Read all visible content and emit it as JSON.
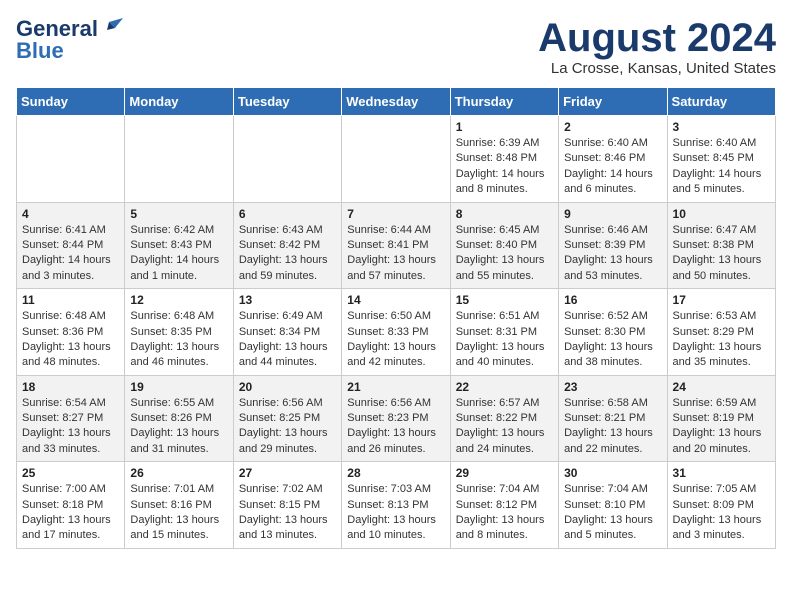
{
  "header": {
    "logo_line1": "General",
    "logo_line2": "Blue",
    "month_title": "August 2024",
    "location": "La Crosse, Kansas, United States"
  },
  "calendar": {
    "days_of_week": [
      "Sunday",
      "Monday",
      "Tuesday",
      "Wednesday",
      "Thursday",
      "Friday",
      "Saturday"
    ],
    "weeks": [
      [
        {
          "day": "",
          "info": ""
        },
        {
          "day": "",
          "info": ""
        },
        {
          "day": "",
          "info": ""
        },
        {
          "day": "",
          "info": ""
        },
        {
          "day": "1",
          "info": "Sunrise: 6:39 AM\nSunset: 8:48 PM\nDaylight: 14 hours and 8 minutes."
        },
        {
          "day": "2",
          "info": "Sunrise: 6:40 AM\nSunset: 8:46 PM\nDaylight: 14 hours and 6 minutes."
        },
        {
          "day": "3",
          "info": "Sunrise: 6:40 AM\nSunset: 8:45 PM\nDaylight: 14 hours and 5 minutes."
        }
      ],
      [
        {
          "day": "4",
          "info": "Sunrise: 6:41 AM\nSunset: 8:44 PM\nDaylight: 14 hours and 3 minutes."
        },
        {
          "day": "5",
          "info": "Sunrise: 6:42 AM\nSunset: 8:43 PM\nDaylight: 14 hours and 1 minute."
        },
        {
          "day": "6",
          "info": "Sunrise: 6:43 AM\nSunset: 8:42 PM\nDaylight: 13 hours and 59 minutes."
        },
        {
          "day": "7",
          "info": "Sunrise: 6:44 AM\nSunset: 8:41 PM\nDaylight: 13 hours and 57 minutes."
        },
        {
          "day": "8",
          "info": "Sunrise: 6:45 AM\nSunset: 8:40 PM\nDaylight: 13 hours and 55 minutes."
        },
        {
          "day": "9",
          "info": "Sunrise: 6:46 AM\nSunset: 8:39 PM\nDaylight: 13 hours and 53 minutes."
        },
        {
          "day": "10",
          "info": "Sunrise: 6:47 AM\nSunset: 8:38 PM\nDaylight: 13 hours and 50 minutes."
        }
      ],
      [
        {
          "day": "11",
          "info": "Sunrise: 6:48 AM\nSunset: 8:36 PM\nDaylight: 13 hours and 48 minutes."
        },
        {
          "day": "12",
          "info": "Sunrise: 6:48 AM\nSunset: 8:35 PM\nDaylight: 13 hours and 46 minutes."
        },
        {
          "day": "13",
          "info": "Sunrise: 6:49 AM\nSunset: 8:34 PM\nDaylight: 13 hours and 44 minutes."
        },
        {
          "day": "14",
          "info": "Sunrise: 6:50 AM\nSunset: 8:33 PM\nDaylight: 13 hours and 42 minutes."
        },
        {
          "day": "15",
          "info": "Sunrise: 6:51 AM\nSunset: 8:31 PM\nDaylight: 13 hours and 40 minutes."
        },
        {
          "day": "16",
          "info": "Sunrise: 6:52 AM\nSunset: 8:30 PM\nDaylight: 13 hours and 38 minutes."
        },
        {
          "day": "17",
          "info": "Sunrise: 6:53 AM\nSunset: 8:29 PM\nDaylight: 13 hours and 35 minutes."
        }
      ],
      [
        {
          "day": "18",
          "info": "Sunrise: 6:54 AM\nSunset: 8:27 PM\nDaylight: 13 hours and 33 minutes."
        },
        {
          "day": "19",
          "info": "Sunrise: 6:55 AM\nSunset: 8:26 PM\nDaylight: 13 hours and 31 minutes."
        },
        {
          "day": "20",
          "info": "Sunrise: 6:56 AM\nSunset: 8:25 PM\nDaylight: 13 hours and 29 minutes."
        },
        {
          "day": "21",
          "info": "Sunrise: 6:56 AM\nSunset: 8:23 PM\nDaylight: 13 hours and 26 minutes."
        },
        {
          "day": "22",
          "info": "Sunrise: 6:57 AM\nSunset: 8:22 PM\nDaylight: 13 hours and 24 minutes."
        },
        {
          "day": "23",
          "info": "Sunrise: 6:58 AM\nSunset: 8:21 PM\nDaylight: 13 hours and 22 minutes."
        },
        {
          "day": "24",
          "info": "Sunrise: 6:59 AM\nSunset: 8:19 PM\nDaylight: 13 hours and 20 minutes."
        }
      ],
      [
        {
          "day": "25",
          "info": "Sunrise: 7:00 AM\nSunset: 8:18 PM\nDaylight: 13 hours and 17 minutes."
        },
        {
          "day": "26",
          "info": "Sunrise: 7:01 AM\nSunset: 8:16 PM\nDaylight: 13 hours and 15 minutes."
        },
        {
          "day": "27",
          "info": "Sunrise: 7:02 AM\nSunset: 8:15 PM\nDaylight: 13 hours and 13 minutes."
        },
        {
          "day": "28",
          "info": "Sunrise: 7:03 AM\nSunset: 8:13 PM\nDaylight: 13 hours and 10 minutes."
        },
        {
          "day": "29",
          "info": "Sunrise: 7:04 AM\nSunset: 8:12 PM\nDaylight: 13 hours and 8 minutes."
        },
        {
          "day": "30",
          "info": "Sunrise: 7:04 AM\nSunset: 8:10 PM\nDaylight: 13 hours and 5 minutes."
        },
        {
          "day": "31",
          "info": "Sunrise: 7:05 AM\nSunset: 8:09 PM\nDaylight: 13 hours and 3 minutes."
        }
      ]
    ]
  }
}
